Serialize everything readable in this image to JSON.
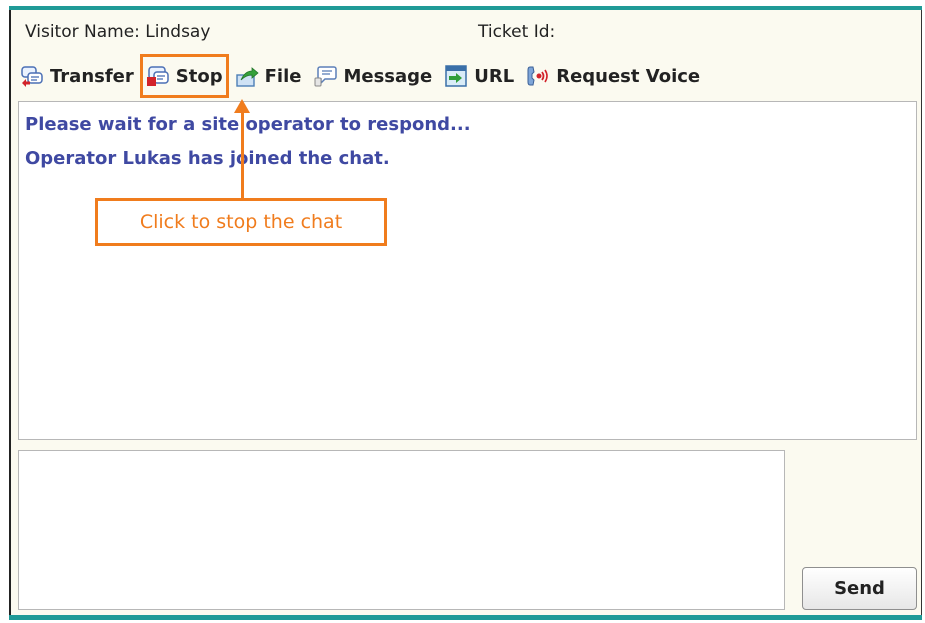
{
  "header": {
    "visitor_name": "Visitor Name: Lindsay",
    "ticket_id": "Ticket Id:"
  },
  "toolbar": {
    "items": [
      {
        "label": "Transfer",
        "icon": "transfer-icon"
      },
      {
        "label": "Stop",
        "icon": "stop-chat-icon"
      },
      {
        "label": "File",
        "icon": "file-upload-icon"
      },
      {
        "label": "Message",
        "icon": "message-icon"
      },
      {
        "label": "URL",
        "icon": "url-push-icon"
      },
      {
        "label": "Request Voice",
        "icon": "voice-request-icon"
      }
    ]
  },
  "transcript": {
    "messages": [
      "Please wait for a site operator to respond...",
      "Operator Lukas has joined the chat."
    ]
  },
  "annotation": {
    "text": "Click to stop the chat",
    "color": "#f07c1d"
  },
  "composer": {
    "value": "",
    "send_label": "Send"
  },
  "colors": {
    "accent": "#1f9a97",
    "message_text": "#3f49a2",
    "annotation": "#f07c1d"
  }
}
